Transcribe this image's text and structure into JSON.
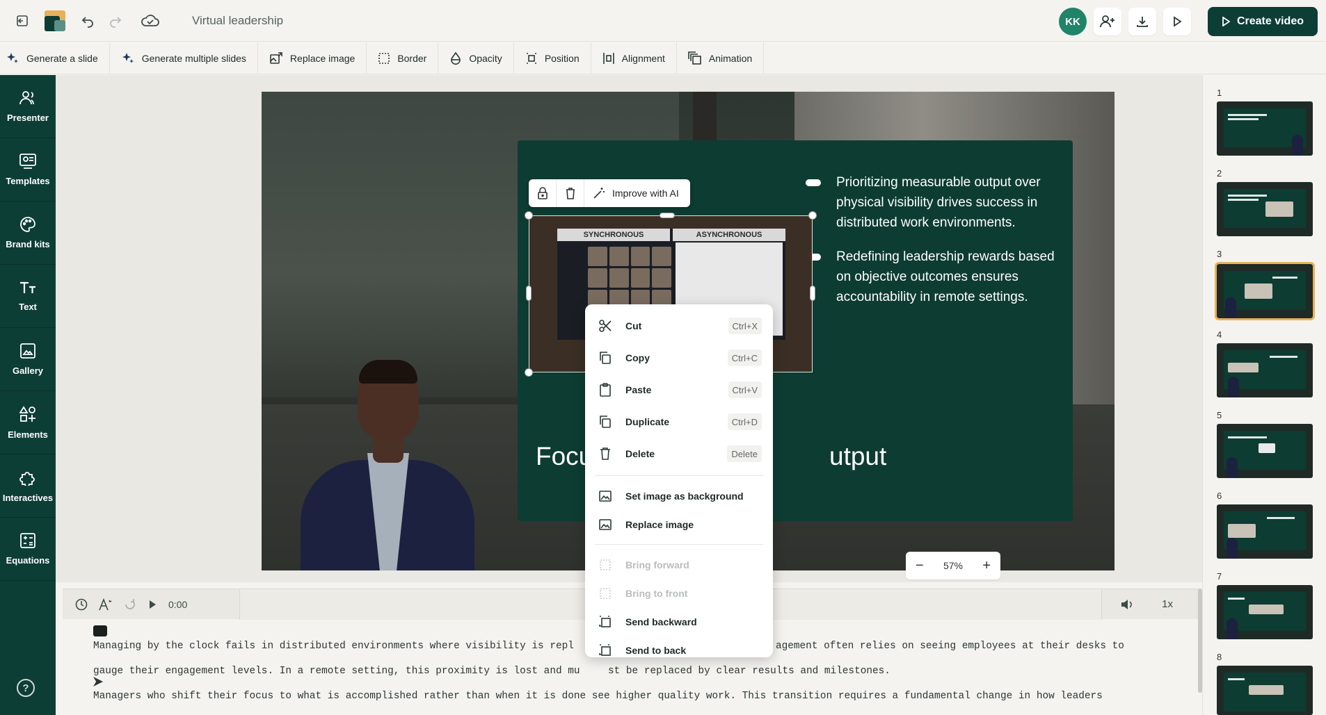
{
  "app": {
    "doc_title": "Virtual leadership",
    "user_initials": "KK",
    "create_label": "Create video"
  },
  "toolbar": [
    {
      "label": "Generate a slide",
      "icon": "sparkle-icon"
    },
    {
      "label": "Generate multiple slides",
      "icon": "sparkle-icon"
    },
    {
      "label": "Replace image",
      "icon": "image-replace-icon"
    },
    {
      "label": "Border",
      "icon": "border-icon"
    },
    {
      "label": "Opacity",
      "icon": "opacity-icon"
    },
    {
      "label": "Position",
      "icon": "position-icon"
    },
    {
      "label": "Alignment",
      "icon": "alignment-icon"
    },
    {
      "label": "Animation",
      "icon": "animation-icon"
    }
  ],
  "sidebar": [
    {
      "label": "Presenter",
      "icon": "presenter-icon"
    },
    {
      "label": "Templates",
      "icon": "templates-icon"
    },
    {
      "label": "Brand kits",
      "icon": "palette-icon"
    },
    {
      "label": "Text",
      "icon": "text-icon"
    },
    {
      "label": "Gallery",
      "icon": "gallery-icon"
    },
    {
      "label": "Elements",
      "icon": "elements-icon"
    },
    {
      "label": "Interactives",
      "icon": "puzzle-icon"
    },
    {
      "label": "Equations",
      "icon": "equations-icon"
    }
  ],
  "slide": {
    "bullets": [
      "Prioritizing measurable output over physical visibility drives success in distributed work environments.",
      "Redefining leadership rewards based on objective outcomes ensures accountability in remote settings."
    ],
    "headline_left": "Focusing",
    "headline_right": "utput",
    "image_tabs": [
      "SYNCHRONOUS",
      "ASYNCHRONOUS"
    ],
    "improve_label": "Improve with AI"
  },
  "zoom": {
    "level": "57%"
  },
  "timeline": {
    "time": "0:00",
    "speed": "1x"
  },
  "script": {
    "lines": [
      "Managing by the clock fails in distributed environments where visibility is repl",
      "gauge their engagement levels. In a remote setting, this proximity is lost and mu",
      "Managers who shift their focus to what is accomplished rather than when it is done see higher quality work. This transition requires a fundamental change in how leaders"
    ],
    "line1_tail": "agement often relies on seeing employees at their desks to",
    "line2_tail": "st be replaced by clear results and milestones."
  },
  "context_menu": {
    "group1": [
      {
        "label": "Cut",
        "shortcut": "Ctrl+X",
        "icon": "scissors-icon"
      },
      {
        "label": "Copy",
        "shortcut": "Ctrl+C",
        "icon": "copy-icon"
      },
      {
        "label": "Paste",
        "shortcut": "Ctrl+V",
        "icon": "clipboard-icon"
      },
      {
        "label": "Duplicate",
        "shortcut": "Ctrl+D",
        "icon": "duplicate-icon"
      },
      {
        "label": "Delete",
        "shortcut": "Delete",
        "icon": "trash-icon"
      }
    ],
    "group2": [
      {
        "label": "Set image as background",
        "icon": "image-icon"
      },
      {
        "label": "Replace image",
        "icon": "image-icon"
      }
    ],
    "group3": [
      {
        "label": "Bring forward",
        "icon": "layer-icon",
        "disabled": true
      },
      {
        "label": "Bring to front",
        "icon": "layer-icon",
        "disabled": true
      },
      {
        "label": "Send backward",
        "icon": "layer-icon",
        "disabled": false
      },
      {
        "label": "Send to back",
        "icon": "layer-icon",
        "disabled": false
      }
    ]
  },
  "thumbnails": {
    "numbers": [
      "1",
      "2",
      "3",
      "4",
      "5",
      "6",
      "7",
      "8"
    ],
    "active": "3"
  },
  "colors": {
    "brand_dark": "#0d3e36",
    "accent": "#e8b05a",
    "avatar": "#1f8468"
  }
}
